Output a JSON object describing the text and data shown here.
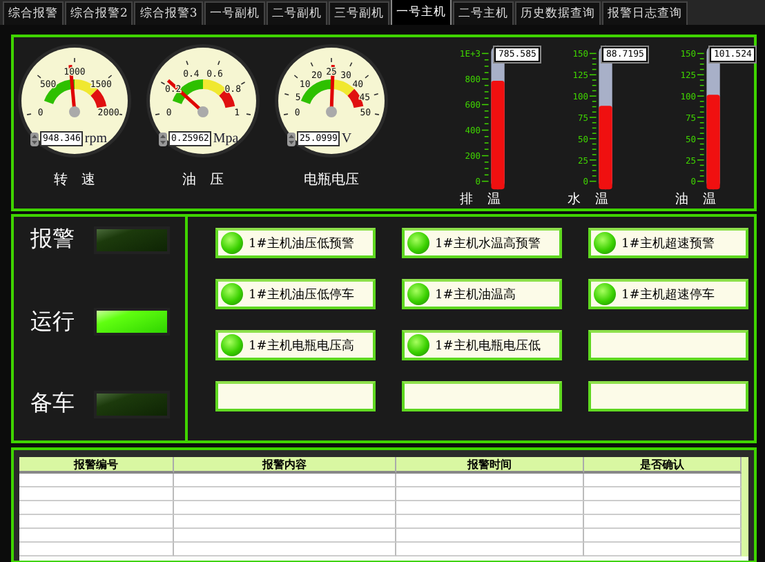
{
  "tabs": [
    {
      "label": "综合报警",
      "selected": false
    },
    {
      "label": "综合报警2",
      "selected": false
    },
    {
      "label": "综合报警3",
      "selected": false
    },
    {
      "label": "一号副机",
      "selected": false
    },
    {
      "label": "二号副机",
      "selected": false
    },
    {
      "label": "三号副机",
      "selected": false
    },
    {
      "label": "一号主机",
      "selected": true
    },
    {
      "label": "二号主机",
      "selected": false
    },
    {
      "label": "历史数据查询",
      "selected": false
    },
    {
      "label": "报警日志查询",
      "selected": false
    }
  ],
  "gauges": [
    {
      "label": "转　速",
      "ticks": [
        "0",
        "500",
        "1000",
        "1500",
        "2000"
      ],
      "level": 0.474,
      "reading": "948.346",
      "unit": "rpm"
    },
    {
      "label": "油　压",
      "ticks": [
        "0",
        "0.2",
        "0.4",
        "0.6",
        "0.8",
        "1"
      ],
      "level": 0.26,
      "reading": "0.25962",
      "unit": "Mpa"
    },
    {
      "label": "电瓶电压",
      "ticks": [
        "0",
        "5",
        "10",
        "20",
        "25",
        "30",
        "40",
        "45",
        "50"
      ],
      "level": 0.51,
      "reading": "25.0999",
      "unit": "V"
    }
  ],
  "thermometers": [
    {
      "label": "排　温",
      "scale": [
        "1E+3",
        "800",
        "600",
        "400",
        "200",
        "0"
      ],
      "level": 0.786,
      "reading": "785.585"
    },
    {
      "label": "水　温",
      "scale": [
        "150",
        "125",
        "100",
        "75",
        "50",
        "25",
        "0"
      ],
      "level": 0.59,
      "reading": "88.7195"
    },
    {
      "label": "油　温",
      "scale": [
        "150",
        "125",
        "100",
        "75",
        "50",
        "25",
        "0"
      ],
      "level": 0.677,
      "reading": "101.524"
    }
  ],
  "status_lamps": [
    {
      "label": "报警",
      "on": false
    },
    {
      "label": "运行",
      "on": true
    },
    {
      "label": "备车",
      "on": false
    }
  ],
  "alarm_indicators": [
    {
      "kind": "lamp",
      "label": "1#主机油压低预警",
      "on": true
    },
    {
      "kind": "lamp",
      "label": "1#主机水温高预警",
      "on": true
    },
    {
      "kind": "lamp",
      "label": "1#主机超速预警",
      "on": true
    },
    {
      "kind": "lamp",
      "label": "1#主机油压低停车",
      "on": true
    },
    {
      "kind": "lamp",
      "label": "1#主机油温高",
      "on": true
    },
    {
      "kind": "lamp",
      "label": "1#主机超速停车",
      "on": true
    },
    {
      "kind": "lamp",
      "label": "1#主机电瓶电压高",
      "on": true
    },
    {
      "kind": "lamp",
      "label": "1#主机电瓶电压低",
      "on": true
    },
    {
      "kind": "blank"
    },
    {
      "kind": "blank"
    },
    {
      "kind": "blank"
    },
    {
      "kind": "blank"
    }
  ],
  "alarm_table": {
    "columns": [
      "报警编号",
      "报警内容",
      "报警时间",
      "是否确认"
    ]
  }
}
